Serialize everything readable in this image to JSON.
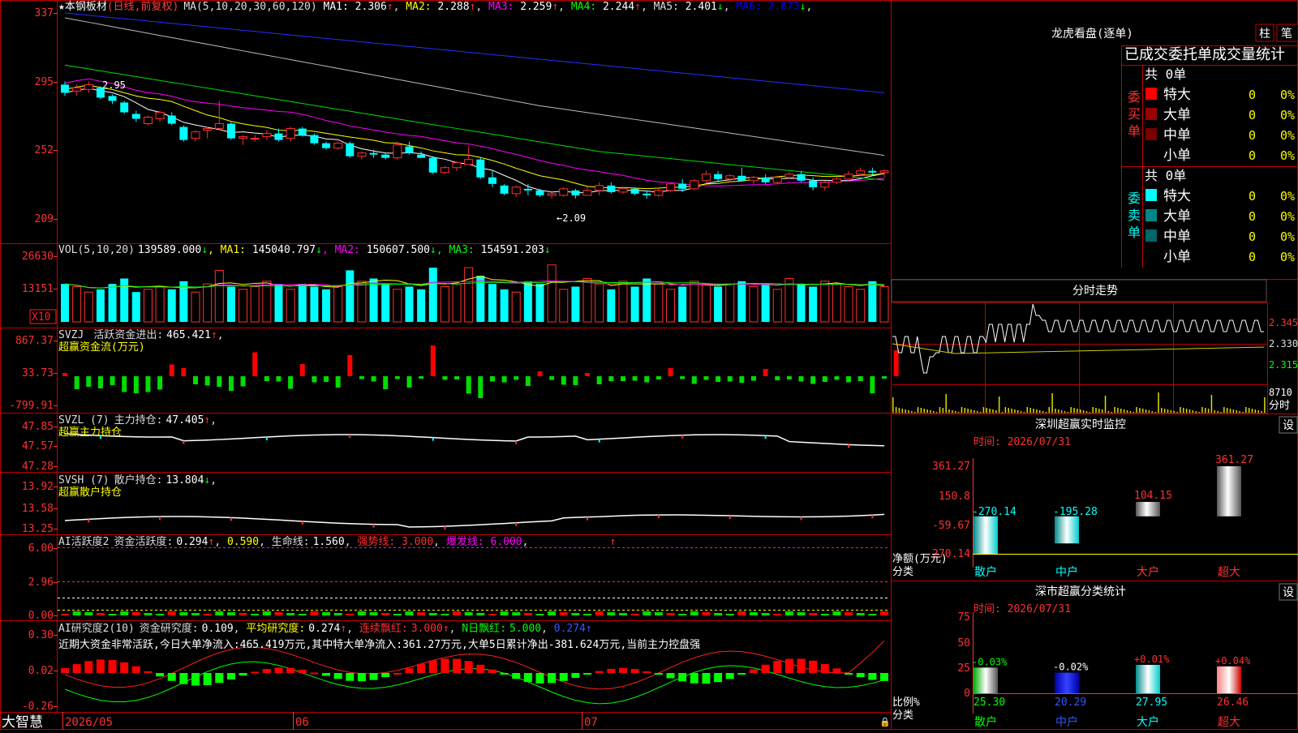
{
  "app": {
    "brand": "大智慧"
  },
  "stock": {
    "name": "本钢板材",
    "mode": "(日线,前复权)"
  },
  "main_chart": {
    "legend_prefix": "MA(5,10,20,30,60,120)",
    "ma": [
      {
        "label": "MA1:",
        "value": "2.306",
        "arrow": "↑",
        "color": "#ffffff"
      },
      {
        "label": "MA2:",
        "value": "2.288",
        "arrow": "↑",
        "color": "#ffff00"
      },
      {
        "label": "MA3:",
        "value": "2.259",
        "arrow": "↑",
        "color": "#ff00ff"
      },
      {
        "label": "MA4:",
        "value": "2.244",
        "arrow": "↑",
        "color": "#00ff00"
      },
      {
        "label": "MA5:",
        "value": "2.401",
        "arrow": "↓",
        "color": "#dddddd"
      },
      {
        "label": "MA6:",
        "value": "2.873",
        "arrow": "↓",
        "color": "#0000ff"
      }
    ],
    "y_ticks": [
      "337",
      "295",
      "252",
      "209"
    ],
    "high_label": "2.95",
    "low_label": "←2.09"
  },
  "vol_panel": {
    "prefix": "VOL(5,10,20)",
    "value": "139589.000",
    "items": [
      {
        "label": "MA1:",
        "value": "145040.797",
        "arrow": "↓",
        "color": "#ffff00"
      },
      {
        "label": "MA2:",
        "value": "150607.500",
        "arrow": "↓",
        "color": "#ff00ff"
      },
      {
        "label": "MA3:",
        "value": "154591.203",
        "arrow": "↓",
        "color": "#00ff00"
      }
    ],
    "y_ticks": [
      "26630",
      "13151"
    ],
    "unit": "X10"
  },
  "svzj_panel": {
    "line1_name": "SVZJ",
    "line1_label": "活跃资金进出:",
    "line1_value": "465.421",
    "line2": "超赢资金流(万元)",
    "y_ticks": [
      "867.37",
      "33.73",
      "-799.91"
    ]
  },
  "svzl_panel": {
    "name": "SVZL (7)",
    "label": "主力持仓:",
    "value": "47.405",
    "line2": "超赢主力持仓",
    "y_ticks": [
      "47.85",
      "47.57",
      "47.28"
    ]
  },
  "svsh_panel": {
    "name": "SVSH (7)",
    "label": "散户持仓:",
    "value": "13.804",
    "line2": "超赢散户持仓",
    "y_ticks": [
      "13.92",
      "13.58",
      "13.25"
    ]
  },
  "ai_active_panel": {
    "name": "AI活跃度2",
    "label1": "资金活跃度:",
    "value1": "0.294",
    "value2": "0.590",
    "label3": "生命线:",
    "value3": "1.560",
    "strong": "强势线: 3.000",
    "burst": "爆发线: 6.000",
    "y_ticks": [
      "6.00",
      "2.96",
      "0.00"
    ]
  },
  "ai_research_panel": {
    "name": "AI研究度2(10)",
    "label1": "资金研究度:",
    "value1": "0.109",
    "label2": "平均研究度:",
    "value2": "0.274",
    "label3": "连续飘红:",
    "value3": "3.000",
    "label4": "N日飘红:",
    "value4": "5.000",
    "value5": "0.274",
    "comment": "近期大资金非常活跃,今日大单净流入:465.419万元,其中特大单净流入:361.27万元,大单5日累计净出-381.624万元,当前主力控盘强",
    "y_ticks": [
      "0.30",
      "0.02",
      "-0.26"
    ]
  },
  "x_axis": {
    "labels": [
      "2026/05",
      "06",
      "07"
    ]
  },
  "right": {
    "tabs": [
      "柱",
      "笔"
    ],
    "lhb_title": "龙虎看盘(逐单)",
    "table_title": "已成交委托单成交量统计",
    "buy": {
      "side_label": "委买单",
      "total": "共 0单",
      "rows": [
        {
          "name": "特大",
          "count": "0",
          "pct": "0%",
          "color": "#ff0000"
        },
        {
          "name": "大单",
          "count": "0",
          "pct": "0%",
          "color": "#990000"
        },
        {
          "name": "中单",
          "count": "0",
          "pct": "0%",
          "color": "#770000"
        },
        {
          "name": "小单",
          "count": "0",
          "pct": "0%",
          "color": "#000000"
        }
      ]
    },
    "sell": {
      "side_label": "委卖单",
      "total": "共 0单",
      "rows": [
        {
          "name": "特大",
          "count": "0",
          "pct": "0%",
          "color": "#00ffff"
        },
        {
          "name": "大单",
          "count": "0",
          "pct": "0%",
          "color": "#008888"
        },
        {
          "name": "中单",
          "count": "0",
          "pct": "0%",
          "color": "#006666"
        },
        {
          "name": "小单",
          "count": "0",
          "pct": "0%",
          "color": "#000000"
        }
      ]
    },
    "intraday": {
      "title": "分时走势",
      "right_ticks": [
        "2.345",
        "2.330",
        "2.315"
      ],
      "vol_tick": "8710",
      "vol_unit": "分时"
    },
    "monitor": {
      "title": "深圳超赢实时监控",
      "settings": "设",
      "time": "时间: 2026/07/31",
      "y_ticks": [
        "361.27",
        "150.8",
        "-59.67",
        "-270.14"
      ],
      "y_label": "净额(万元)",
      "x_label": "分类",
      "categories": [
        "散户",
        "中户",
        "大户",
        "超大"
      ],
      "values": [
        "-270.14",
        "-195.28",
        "104.15",
        "361.27"
      ]
    },
    "classify": {
      "title": "深市超赢分类统计",
      "settings": "设",
      "time": "时间: 2026/07/31",
      "y_ticks": [
        "75",
        "50",
        "25",
        "0"
      ],
      "y_label": "比例%",
      "x_label": "分类",
      "categories": [
        "散户",
        "中户",
        "大户",
        "超大"
      ],
      "pct_labels": [
        "-0.03%",
        "-0.02%",
        "+0.01%",
        "+0.04%"
      ],
      "values": [
        "25.30",
        "20.29",
        "27.95",
        "26.46"
      ]
    }
  },
  "chart_data": [
    {
      "type": "bar",
      "title": "深圳超赢实时监控",
      "xlabel": "分类",
      "ylabel": "净额(万元)",
      "categories": [
        "散户",
        "中户",
        "大户",
        "超大"
      ],
      "values": [
        -270.14,
        -195.28,
        104.15,
        361.27
      ],
      "ylim": [
        -270.14,
        361.27
      ]
    },
    {
      "type": "bar",
      "title": "深市超赢分类统计",
      "xlabel": "分类",
      "ylabel": "比例%",
      "categories": [
        "散户",
        "中户",
        "大户",
        "超大"
      ],
      "values": [
        25.3,
        20.29,
        27.95,
        26.46
      ],
      "changes": [
        "-0.03%",
        "-0.02%",
        "+0.01%",
        "+0.04%"
      ],
      "ylim": [
        0,
        75
      ]
    }
  ],
  "series": {
    "candles": [
      [
        2.93,
        2.95,
        2.86,
        2.88
      ],
      [
        2.89,
        2.93,
        2.86,
        2.91
      ],
      [
        2.9,
        2.95,
        2.88,
        2.93
      ],
      [
        2.91,
        2.92,
        2.84,
        2.85
      ],
      [
        2.86,
        2.87,
        2.81,
        2.83
      ],
      [
        2.82,
        2.83,
        2.75,
        2.76
      ],
      [
        2.75,
        2.77,
        2.7,
        2.72
      ],
      [
        2.69,
        2.74,
        2.68,
        2.73
      ],
      [
        2.72,
        2.77,
        2.7,
        2.76
      ],
      [
        2.74,
        2.76,
        2.68,
        2.69
      ],
      [
        2.67,
        2.68,
        2.58,
        2.59
      ],
      [
        2.6,
        2.65,
        2.58,
        2.64
      ],
      [
        2.65,
        2.67,
        2.6,
        2.66
      ],
      [
        2.66,
        2.83,
        2.65,
        2.69
      ],
      [
        2.69,
        2.7,
        2.59,
        2.6
      ],
      [
        2.6,
        2.62,
        2.56,
        2.61
      ],
      [
        2.6,
        2.62,
        2.58,
        2.6
      ],
      [
        2.61,
        2.65,
        2.59,
        2.63
      ],
      [
        2.63,
        2.66,
        2.58,
        2.59
      ],
      [
        2.6,
        2.67,
        2.58,
        2.66
      ],
      [
        2.66,
        2.67,
        2.61,
        2.62
      ],
      [
        2.62,
        2.63,
        2.56,
        2.57
      ],
      [
        2.57,
        2.58,
        2.53,
        2.54
      ],
      [
        2.54,
        2.58,
        2.53,
        2.57
      ],
      [
        2.57,
        2.58,
        2.48,
        2.49
      ],
      [
        2.49,
        2.52,
        2.47,
        2.51
      ],
      [
        2.51,
        2.53,
        2.48,
        2.5
      ],
      [
        2.5,
        2.51,
        2.47,
        2.48
      ],
      [
        2.48,
        2.58,
        2.47,
        2.56
      ],
      [
        2.55,
        2.58,
        2.5,
        2.51
      ],
      [
        2.5,
        2.52,
        2.48,
        2.48
      ],
      [
        2.48,
        2.49,
        2.38,
        2.39
      ],
      [
        2.39,
        2.43,
        2.38,
        2.42
      ],
      [
        2.42,
        2.46,
        2.4,
        2.45
      ],
      [
        2.44,
        2.55,
        2.44,
        2.47
      ],
      [
        2.47,
        2.48,
        2.35,
        2.36
      ],
      [
        2.36,
        2.4,
        2.3,
        2.32
      ],
      [
        2.31,
        2.32,
        2.25,
        2.26
      ],
      [
        2.26,
        2.31,
        2.24,
        2.3
      ],
      [
        2.29,
        2.32,
        2.25,
        2.28
      ],
      [
        2.28,
        2.29,
        2.24,
        2.25
      ],
      [
        2.25,
        2.27,
        2.23,
        2.26
      ],
      [
        2.25,
        2.3,
        2.24,
        2.29
      ],
      [
        2.28,
        2.29,
        2.23,
        2.25
      ],
      [
        2.25,
        2.3,
        2.25,
        2.28
      ],
      [
        2.28,
        2.33,
        2.25,
        2.31
      ],
      [
        2.31,
        2.33,
        2.26,
        2.27
      ],
      [
        2.27,
        2.3,
        2.26,
        2.29
      ],
      [
        2.29,
        2.3,
        2.25,
        2.26
      ],
      [
        2.26,
        2.28,
        2.23,
        2.25
      ],
      [
        2.25,
        2.3,
        2.24,
        2.28
      ],
      [
        2.28,
        2.33,
        2.27,
        2.32
      ],
      [
        2.32,
        2.35,
        2.27,
        2.29
      ],
      [
        2.29,
        2.35,
        2.28,
        2.34
      ],
      [
        2.34,
        2.4,
        2.32,
        2.38
      ],
      [
        2.38,
        2.4,
        2.33,
        2.35
      ],
      [
        2.35,
        2.38,
        2.33,
        2.37
      ],
      [
        2.37,
        2.42,
        2.35,
        2.34
      ],
      [
        2.34,
        2.37,
        2.32,
        2.36
      ],
      [
        2.36,
        2.38,
        2.32,
        2.33
      ],
      [
        2.33,
        2.37,
        2.32,
        2.36
      ],
      [
        2.36,
        2.39,
        2.35,
        2.38
      ],
      [
        2.38,
        2.4,
        2.33,
        2.34
      ],
      [
        2.34,
        2.36,
        2.28,
        2.3
      ],
      [
        2.3,
        2.34,
        2.28,
        2.33
      ],
      [
        2.33,
        2.36,
        2.32,
        2.35
      ],
      [
        2.35,
        2.4,
        2.34,
        2.38
      ],
      [
        2.38,
        2.42,
        2.37,
        2.4
      ],
      [
        2.4,
        2.42,
        2.37,
        2.39
      ],
      [
        2.39,
        2.41,
        2.36,
        2.4
      ]
    ],
    "volumes": [
      14,
      13,
      11,
      12,
      14,
      16,
      11,
      12,
      13,
      12,
      15,
      11,
      14,
      19,
      13,
      12,
      13,
      15,
      14,
      12,
      14,
      13,
      12,
      13,
      19,
      15,
      16,
      14,
      12,
      13,
      12,
      20,
      13,
      14,
      20,
      17,
      14,
      12,
      11,
      15,
      14,
      21,
      12,
      13,
      16,
      14,
      12,
      15,
      13,
      16,
      14,
      12,
      13,
      15,
      14,
      13,
      14,
      15,
      13,
      14,
      12,
      16,
      14,
      13,
      15,
      14,
      13,
      12,
      15,
      13
    ],
    "svzj": [
      80,
      -320,
      -260,
      -300,
      -220,
      -390,
      -420,
      -390,
      -330,
      290,
      200,
      -200,
      -230,
      -260,
      -360,
      -250,
      590,
      -120,
      -130,
      -310,
      300,
      -150,
      -140,
      -280,
      520,
      -70,
      -130,
      -320,
      -70,
      -280,
      -60,
      760,
      -90,
      -80,
      -430,
      -540,
      -130,
      -150,
      -90,
      -240,
      120,
      -90,
      -210,
      -220,
      80,
      -200,
      -120,
      -120,
      -110,
      -150,
      -80,
      200,
      -70,
      -190,
      -90,
      -140,
      -130,
      -160,
      -110,
      180,
      -100,
      -80,
      -130,
      -190,
      -140,
      -90,
      -150,
      -120,
      -420,
      -60,
      640
    ]
  }
}
